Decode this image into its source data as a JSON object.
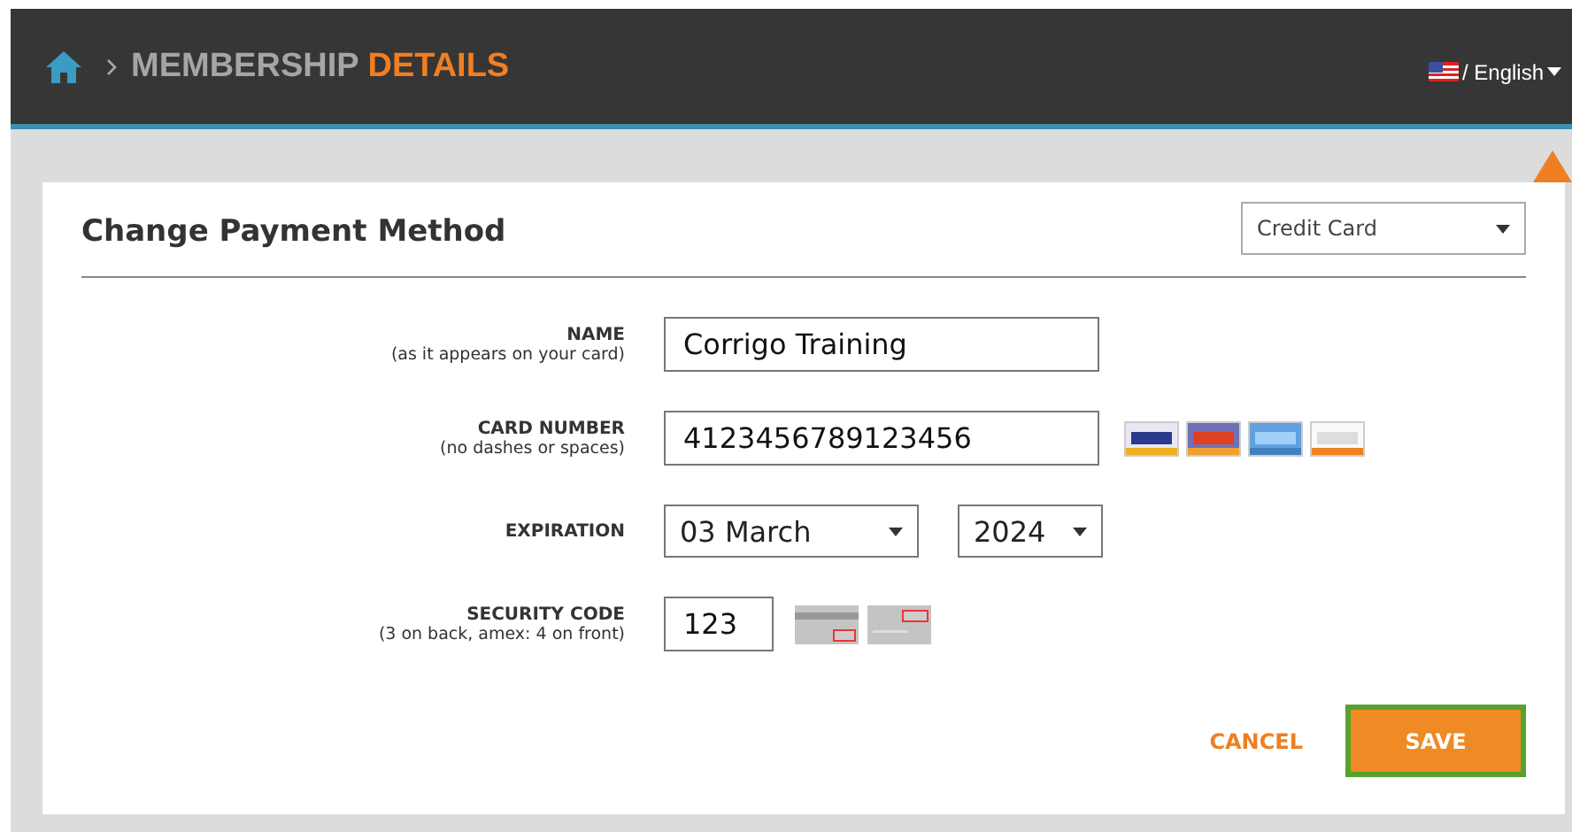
{
  "header": {
    "breadcrumb": {
      "title": "MEMBERSHIP",
      "highlight": "DETAILS"
    },
    "language": "/ English"
  },
  "form": {
    "title": "Change Payment Method",
    "payment_type": "Credit Card",
    "rows": [
      {
        "kind": "text",
        "label": "NAME",
        "hint": "(as it appears on your card)",
        "value": "Corrigo Training"
      },
      {
        "kind": "card",
        "label": "CARD NUMBER",
        "hint": "(no dashes or spaces)",
        "value": "4123456789123456"
      },
      {
        "kind": "expiry",
        "label": "EXPIRATION",
        "month": "03 March",
        "year": "2024"
      },
      {
        "kind": "cvv",
        "label": "SECURITY CODE",
        "hint": "(3 on back, amex: 4 on front)",
        "value": "123"
      }
    ]
  },
  "buttons": [
    {
      "kind": "link",
      "label": "CANCEL"
    },
    {
      "kind": "primary",
      "label": "SAVE",
      "focused": true
    }
  ]
}
